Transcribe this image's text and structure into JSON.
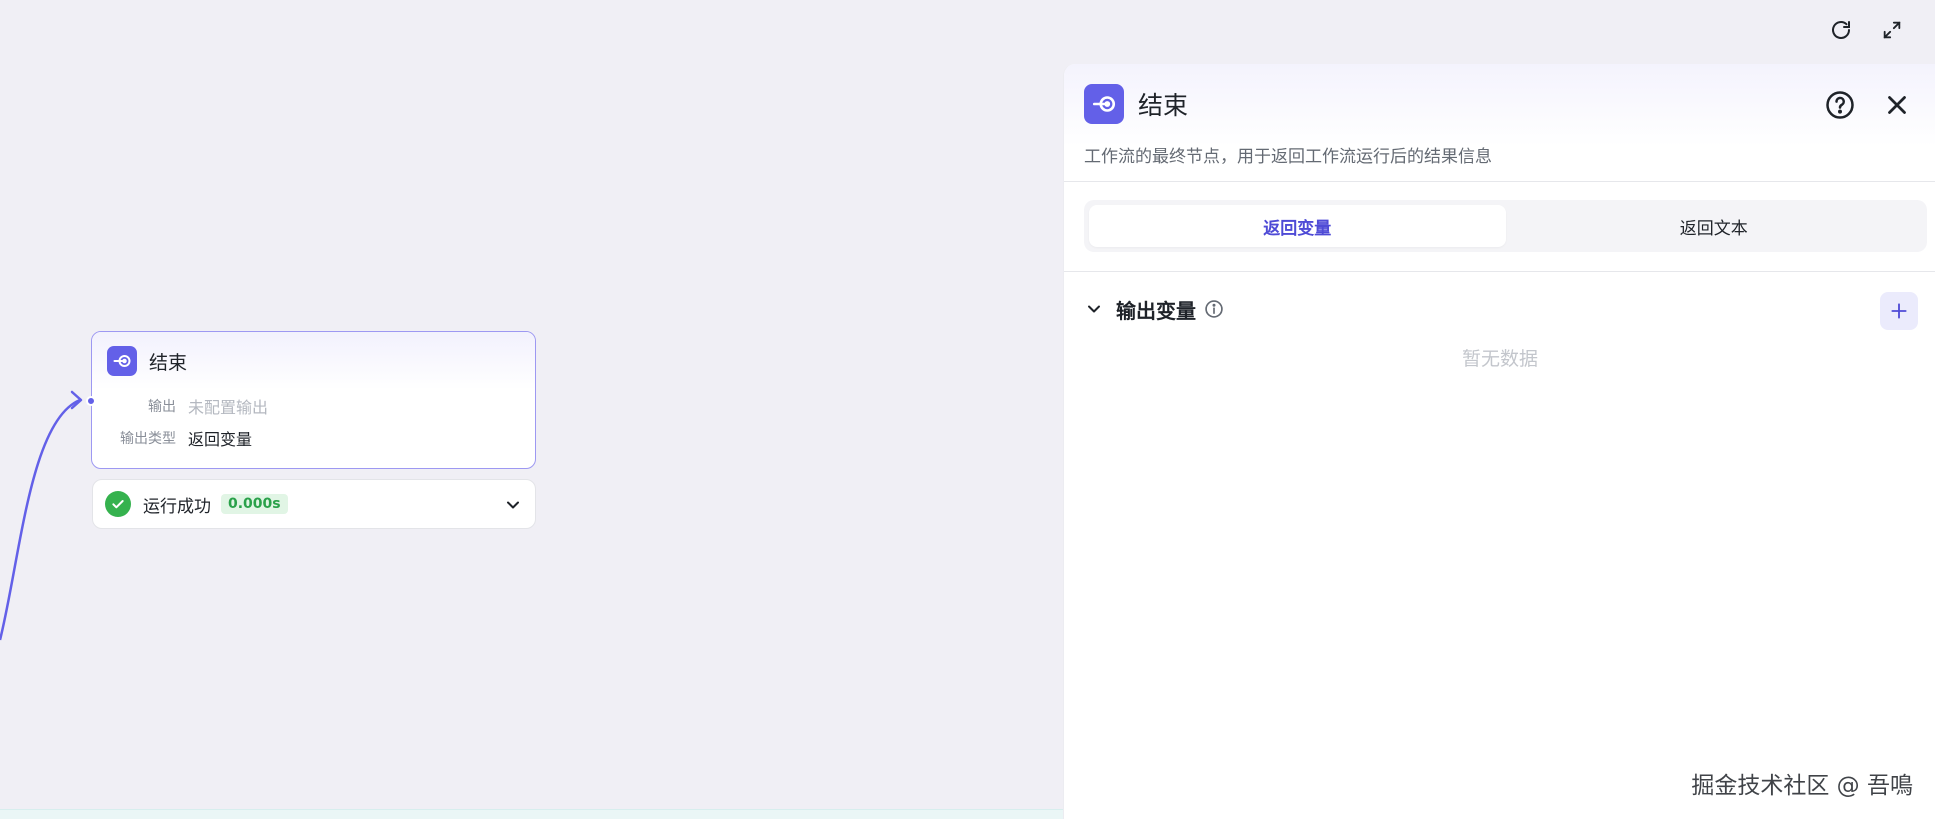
{
  "canvas": {
    "node": {
      "title": "结束",
      "fields": [
        {
          "key": "输出",
          "value": "未配置输出"
        },
        {
          "key": "输出类型",
          "value": "返回变量"
        }
      ]
    },
    "run_status": {
      "label": "运行成功",
      "duration": "0.000s"
    }
  },
  "panel": {
    "title": "结束",
    "description": "工作流的最终节点，用于返回工作流运行后的结果信息",
    "tabs": [
      {
        "label": "返回变量",
        "active": true
      },
      {
        "label": "返回文本",
        "active": false
      }
    ],
    "section": {
      "title": "输出变量",
      "empty_text": "暂无数据"
    }
  },
  "watermark": "掘金技术社区 @ 吾鳴",
  "colors": {
    "accent": "#6360e8",
    "success": "#35b24e",
    "canvas_bg": "#f0eff5"
  }
}
